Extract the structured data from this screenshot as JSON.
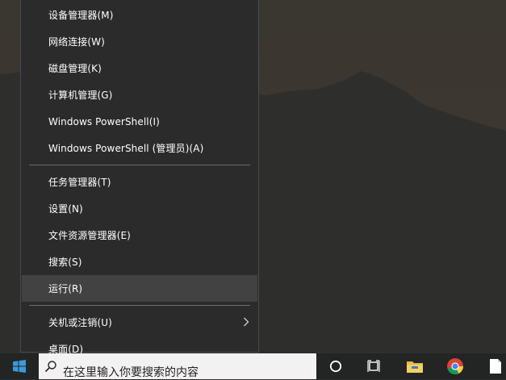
{
  "menu": {
    "group1": [
      {
        "label": "设备管理器(M)"
      },
      {
        "label": "网络连接(W)"
      },
      {
        "label": "磁盘管理(K)"
      },
      {
        "label": "计算机管理(G)"
      },
      {
        "label": "Windows PowerShell(I)"
      },
      {
        "label": "Windows PowerShell (管理员)(A)"
      }
    ],
    "group2": [
      {
        "label": "任务管理器(T)"
      },
      {
        "label": "设置(N)"
      },
      {
        "label": "文件资源管理器(E)"
      },
      {
        "label": "搜索(S)"
      },
      {
        "label": "运行(R)",
        "highlighted": true
      }
    ],
    "group3": [
      {
        "label": "关机或注销(U)",
        "has_submenu": true
      },
      {
        "label": "桌面(D)"
      }
    ]
  },
  "taskbar": {
    "search_placeholder": "在这里输入你要搜索的内容",
    "icons": [
      "windows-start-icon",
      "search-icon",
      "cortana-icon",
      "task-view-icon",
      "file-explorer-icon",
      "chrome-icon",
      "document-icon"
    ]
  },
  "colors": {
    "menu_bg": "#2b2b2b",
    "menu_hover": "#424242",
    "taskbar_bg": "#232424",
    "start_blue": "#3a9bdc"
  }
}
